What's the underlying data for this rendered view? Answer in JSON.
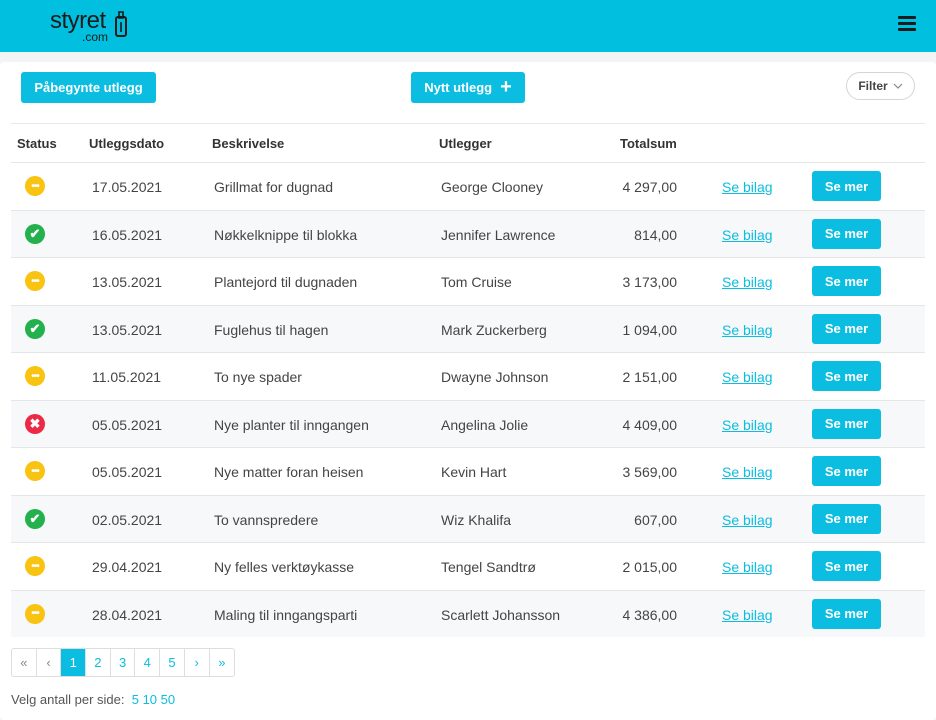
{
  "brand": {
    "word": "styret",
    "domain": ".com"
  },
  "toolbar": {
    "started_label": "Påbegynte utlegg",
    "new_label": "Nytt utlegg",
    "filter_label": "Filter"
  },
  "table": {
    "headers": [
      "Status",
      "Utleggsdato",
      "Beskrivelse",
      "Utlegger",
      "Totalsum"
    ],
    "rows": [
      {
        "status": "pending",
        "date": "17.05.2021",
        "desc": "Grillmat for dugnad",
        "user": "George Clooney",
        "sum": "4 297,00",
        "link": "Se bilag",
        "action": "Se mer"
      },
      {
        "status": "approved",
        "date": "16.05.2021",
        "desc": "Nøkkelknippe til blokka",
        "user": "Jennifer Lawrence",
        "sum": "814,00",
        "link": "Se bilag",
        "action": "Se mer"
      },
      {
        "status": "pending",
        "date": "13.05.2021",
        "desc": "Plantejord til dugnaden",
        "user": "Tom Cruise",
        "sum": "3 173,00",
        "link": "Se bilag",
        "action": "Se mer"
      },
      {
        "status": "approved",
        "date": "13.05.2021",
        "desc": "Fuglehus til hagen",
        "user": "Mark Zuckerberg",
        "sum": "1 094,00",
        "link": "Se bilag",
        "action": "Se mer"
      },
      {
        "status": "pending",
        "date": "11.05.2021",
        "desc": "To nye spader",
        "user": "Dwayne Johnson",
        "sum": "2 151,00",
        "link": "Se bilag",
        "action": "Se mer"
      },
      {
        "status": "rejected",
        "date": "05.05.2021",
        "desc": "Nye planter til inngangen",
        "user": "Angelina Jolie",
        "sum": "4 409,00",
        "link": "Se bilag",
        "action": "Se mer"
      },
      {
        "status": "pending",
        "date": "05.05.2021",
        "desc": "Nye matter foran heisen",
        "user": "Kevin Hart",
        "sum": "3 569,00",
        "link": "Se bilag",
        "action": "Se mer"
      },
      {
        "status": "approved",
        "date": "02.05.2021",
        "desc": "To vannspredere",
        "user": "Wiz Khalifa",
        "sum": "607,00",
        "link": "Se bilag",
        "action": "Se mer"
      },
      {
        "status": "pending",
        "date": "29.04.2021",
        "desc": "Ny felles verktøykasse",
        "user": "Tengel Sandtrø",
        "sum": "2 015,00",
        "link": "Se bilag",
        "action": "Se mer"
      },
      {
        "status": "pending",
        "date": "28.04.2021",
        "desc": "Maling til inngangsparti",
        "user": "Scarlett Johansson",
        "sum": "4 386,00",
        "link": "Se bilag",
        "action": "Se mer"
      }
    ]
  },
  "status_icons": {
    "pending": "pending-icon",
    "approved": "check-icon",
    "rejected": "x-icon"
  },
  "colors": {
    "accent": "#0bbde0",
    "pending": "#f9c311",
    "approved": "#22b14c",
    "rejected": "#ea2a47"
  },
  "pagination": {
    "first": "«",
    "prev": "‹",
    "next": "›",
    "last": "»",
    "pages": [
      "1",
      "2",
      "3",
      "4",
      "5"
    ],
    "current": "1"
  },
  "per_page": {
    "label": "Velg antall per side:",
    "options": [
      "5",
      "10",
      "50"
    ]
  }
}
